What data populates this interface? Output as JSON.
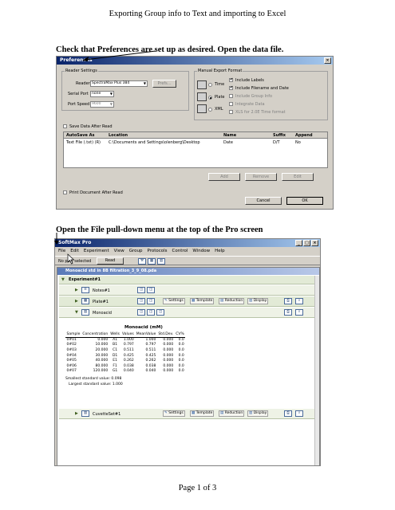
{
  "page": {
    "header": "Exporting Group info to Text and importing to Excel",
    "instruction1": "Check that Preferences are set up as desired.  Open the data file.",
    "instruction2": "Open the File pull-down menu at the top of the Pro screen",
    "footer": "Page 1 of 3"
  },
  "prefs": {
    "title": "Preferences",
    "reader_settings": "Reader Settings",
    "reader_label": "Reader",
    "reader_value": "SpectraMax Plus 384",
    "serial_label": "Serial Port",
    "serial_value": "none",
    "speed_label": "Port Speed",
    "speed_value": "9600",
    "prefs_btn": "Prefs...",
    "manual_export": "Manual Export Format",
    "time_label": "Time",
    "plate_label": "Plate",
    "xml_label": "XML",
    "include_labels": "Include Labels",
    "include_filename": "Include Filename and Date",
    "include_group": "Include Group Info",
    "integrate_data": "Integrate Data",
    "excel_format": "XLS for 2.0E Time format",
    "save_after_read": "Save Data After Read",
    "col_autosave": "AutoSave As",
    "col_location": "Location",
    "col_name": "Name",
    "col_suffix": "Suffix",
    "col_append": "Append",
    "row_type": "Text File (.txt) (R)",
    "row_location": "C:\\Documents and Settings\\olenberg\\Desktop",
    "row_name": "Date",
    "row_suffix": "D/T",
    "row_append": "No",
    "add_btn": "Add",
    "remove_btn": "Remove",
    "edit_btn": "Edit",
    "print_after_read": "Print Document After Read",
    "cancel_btn": "Cancel",
    "ok_btn": "OK"
  },
  "softmax": {
    "title": "SoftMax Pro",
    "menu": [
      "File",
      "Edit",
      "Experiment",
      "View",
      "Group",
      "Protocols",
      "Control",
      "Window",
      "Help"
    ],
    "status": "No port selected",
    "read_btn": "Read",
    "doc_title": "Monoacid std in 8B filtration_3_9_08.pda",
    "experiment": "Experiment#1",
    "notes": "Notes#1",
    "plate": "Plate#1",
    "monoacid": "Monoacid",
    "cuvette": "CuvetteSet#1",
    "settings_btn": "Settings",
    "template_btn": "Template",
    "reduction_btn": "Reduction",
    "display_btn": "Display",
    "group_title": "Monoacid (mM)",
    "std_value": "Smallest standard value: 0.098",
    "lg_std_value": "Largest standard value: 1.000"
  },
  "table": {
    "headers": [
      "Sample",
      "Concentration",
      "Wells",
      "Values",
      "MeanValue",
      "Std.Dev.",
      "CV%"
    ],
    "rows": [
      [
        "0#01",
        "0.000",
        "A1",
        "1.000",
        "1.000",
        "0.000",
        "0.0"
      ],
      [
        "0#02",
        "10.000",
        "B1",
        "0.797",
        "0.797",
        "0.000",
        "0.0"
      ],
      [
        "0#03",
        "20.000",
        "C1",
        "0.511",
        "0.511",
        "0.000",
        "0.0"
      ],
      [
        "0#04",
        "30.000",
        "D1",
        "0.425",
        "0.425",
        "0.000",
        "0.0"
      ],
      [
        "0#05",
        "40.000",
        "E1",
        "0.262",
        "0.262",
        "0.000",
        "0.0"
      ],
      [
        "0#06",
        "80.000",
        "F1",
        "0.038",
        "0.038",
        "0.000",
        "0.0"
      ],
      [
        "0#07",
        "120.000",
        "G1",
        "0.040",
        "0.040",
        "0.000",
        "0.0"
      ]
    ]
  }
}
